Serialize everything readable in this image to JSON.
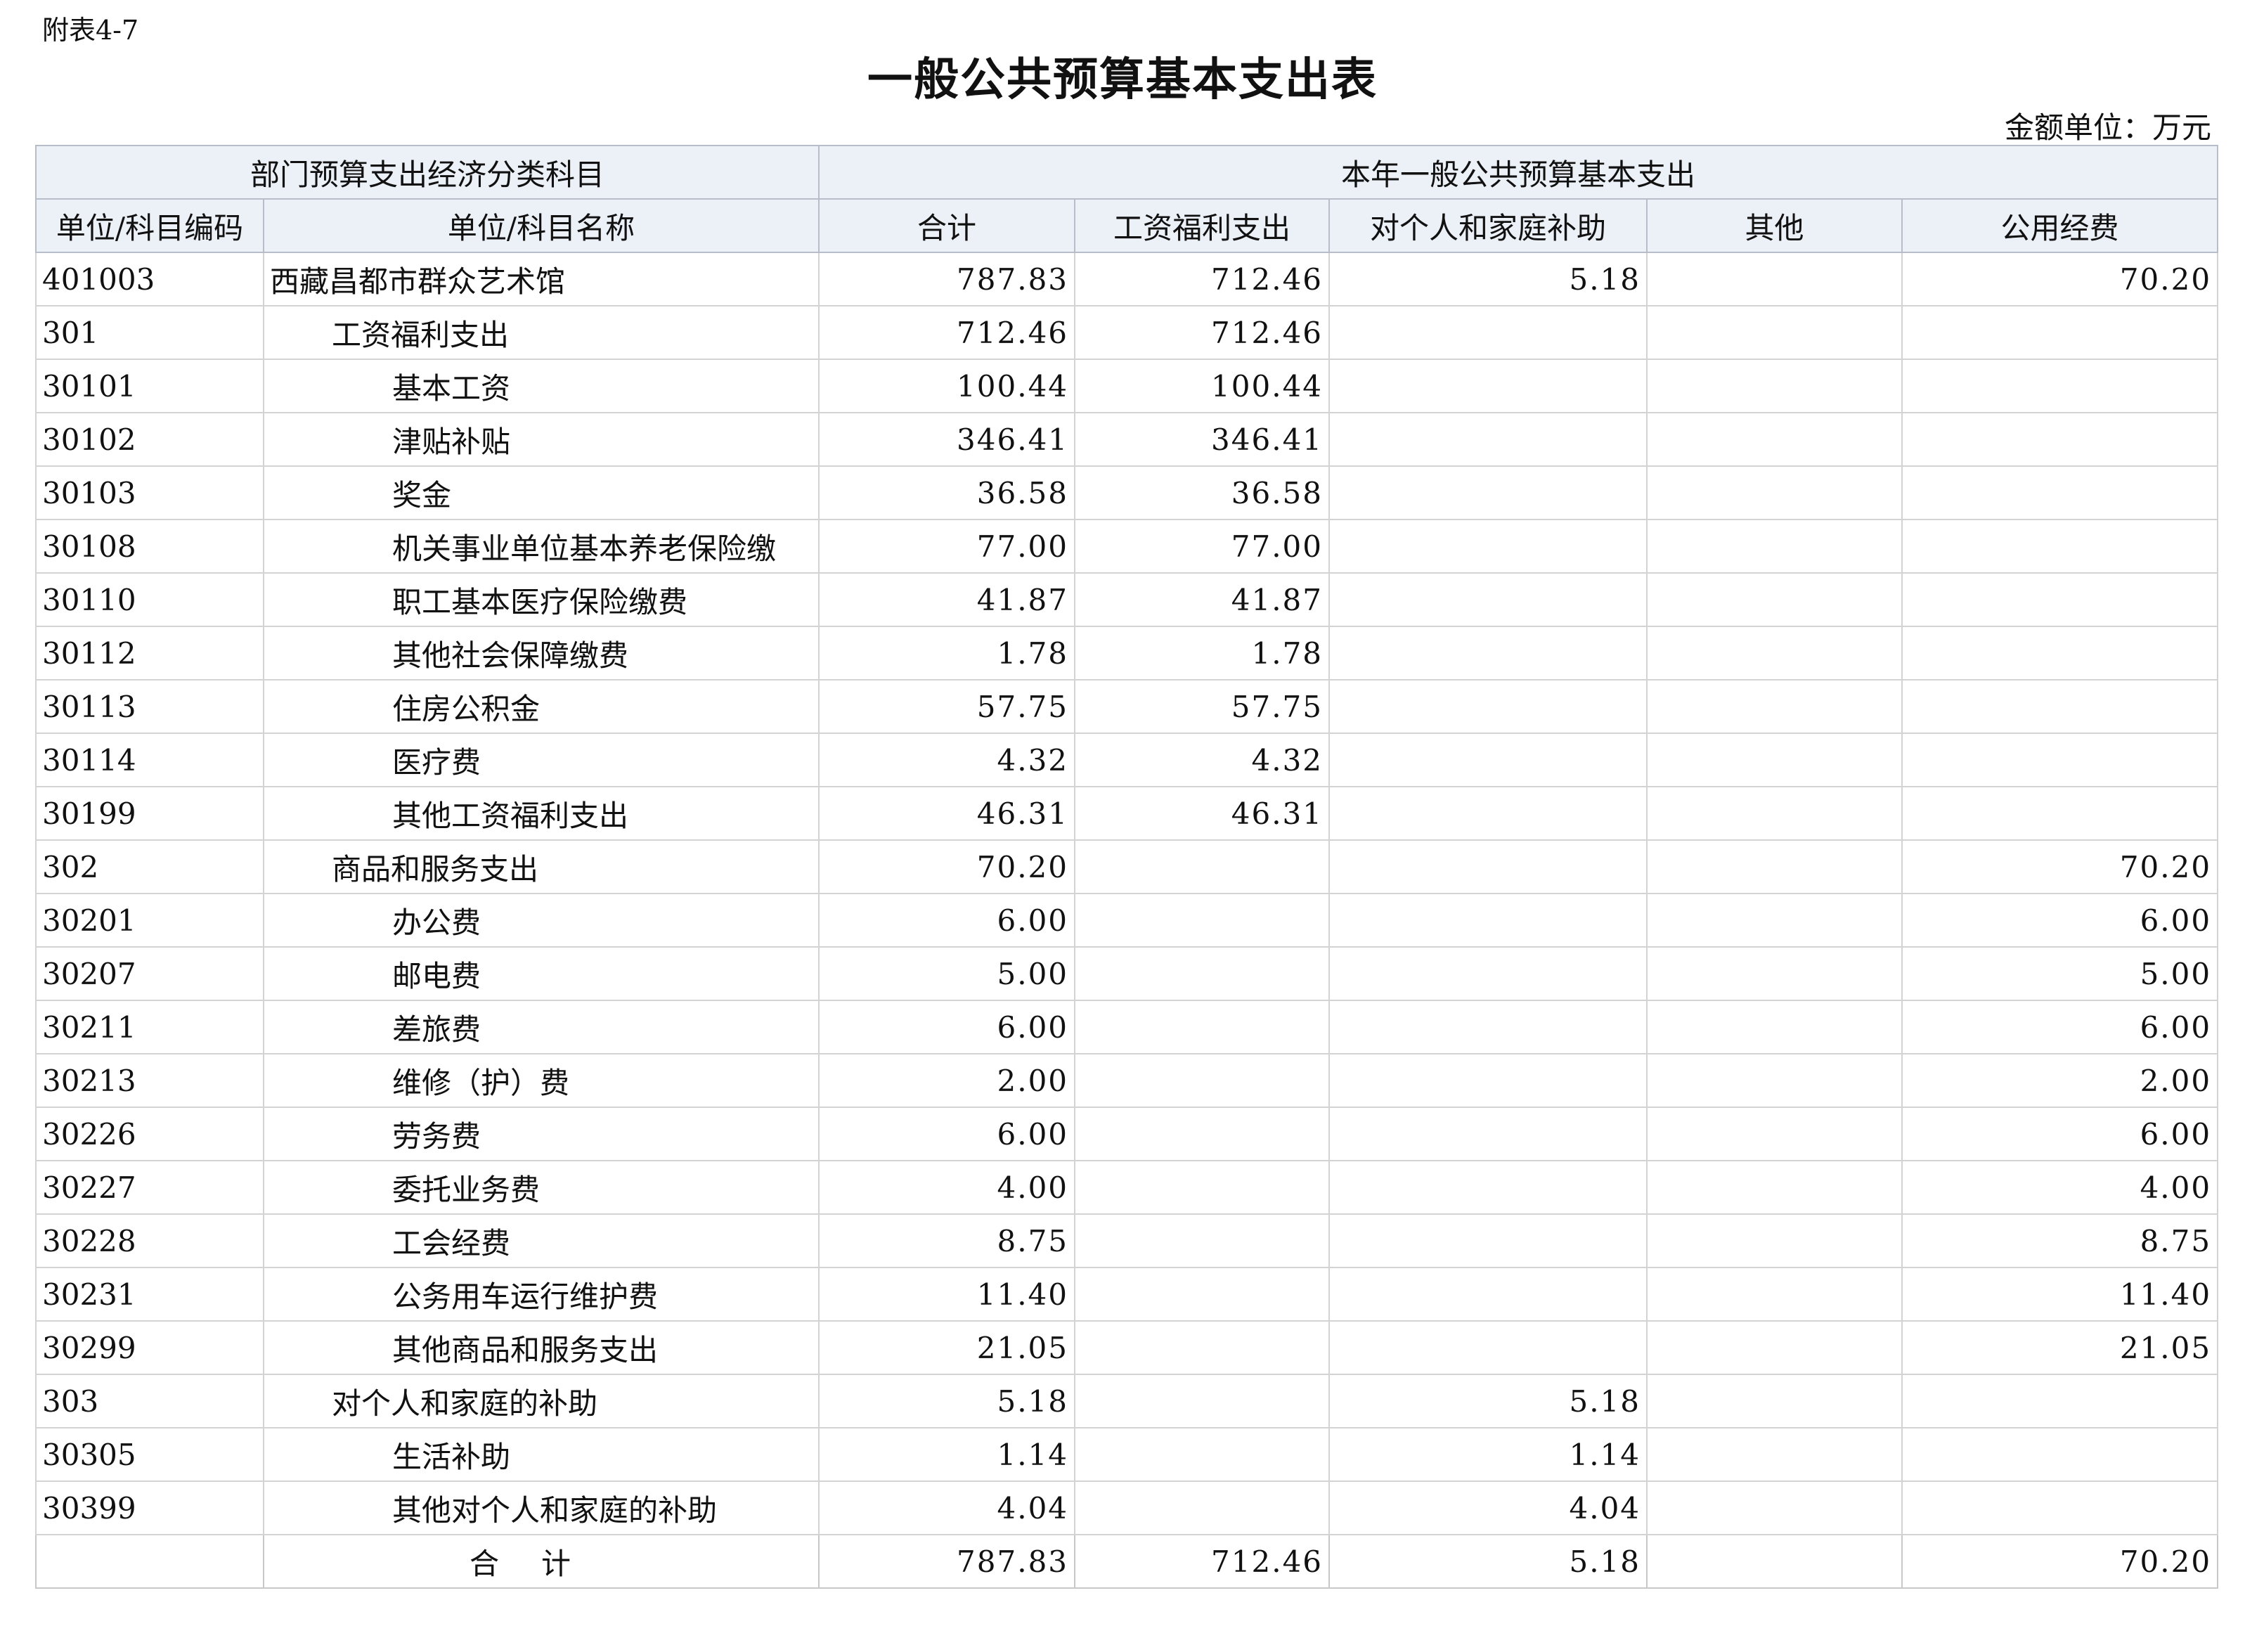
{
  "annex_label": "附表4-7",
  "title": "一般公共预算基本支出表",
  "unit_label": "金额单位：万元",
  "header": {
    "group1": "部门预算支出经济分类科目",
    "group2": "本年一般公共预算基本支出",
    "col_code": "单位/科目编码",
    "col_name": "单位/科目名称",
    "col_total": "合计",
    "col_salary": "工资福利支出",
    "col_subsidy": "对个人和家庭补助",
    "col_other": "其他",
    "col_public": "公用经费"
  },
  "rows": [
    {
      "code": "401003",
      "name": "西藏昌都市群众艺术馆",
      "level": 1,
      "total": "787.83",
      "salary": "712.46",
      "subsidy": "5.18",
      "other": "",
      "public": "70.20"
    },
    {
      "code": "301",
      "name": "工资福利支出",
      "level": 2,
      "total": "712.46",
      "salary": "712.46",
      "subsidy": "",
      "other": "",
      "public": ""
    },
    {
      "code": "30101",
      "name": "基本工资",
      "level": 3,
      "total": "100.44",
      "salary": "100.44",
      "subsidy": "",
      "other": "",
      "public": ""
    },
    {
      "code": "30102",
      "name": "津贴补贴",
      "level": 3,
      "total": "346.41",
      "salary": "346.41",
      "subsidy": "",
      "other": "",
      "public": ""
    },
    {
      "code": "30103",
      "name": "奖金",
      "level": 3,
      "total": "36.58",
      "salary": "36.58",
      "subsidy": "",
      "other": "",
      "public": ""
    },
    {
      "code": "30108",
      "name": "机关事业单位基本养老保险缴",
      "level": 3,
      "total": "77.00",
      "salary": "77.00",
      "subsidy": "",
      "other": "",
      "public": ""
    },
    {
      "code": "30110",
      "name": "职工基本医疗保险缴费",
      "level": 3,
      "total": "41.87",
      "salary": "41.87",
      "subsidy": "",
      "other": "",
      "public": ""
    },
    {
      "code": "30112",
      "name": "其他社会保障缴费",
      "level": 3,
      "total": "1.78",
      "salary": "1.78",
      "subsidy": "",
      "other": "",
      "public": ""
    },
    {
      "code": "30113",
      "name": "住房公积金",
      "level": 3,
      "total": "57.75",
      "salary": "57.75",
      "subsidy": "",
      "other": "",
      "public": ""
    },
    {
      "code": "30114",
      "name": "医疗费",
      "level": 3,
      "total": "4.32",
      "salary": "4.32",
      "subsidy": "",
      "other": "",
      "public": ""
    },
    {
      "code": "30199",
      "name": "其他工资福利支出",
      "level": 3,
      "total": "46.31",
      "salary": "46.31",
      "subsidy": "",
      "other": "",
      "public": ""
    },
    {
      "code": "302",
      "name": "商品和服务支出",
      "level": 2,
      "total": "70.20",
      "salary": "",
      "subsidy": "",
      "other": "",
      "public": "70.20"
    },
    {
      "code": "30201",
      "name": "办公费",
      "level": 3,
      "total": "6.00",
      "salary": "",
      "subsidy": "",
      "other": "",
      "public": "6.00"
    },
    {
      "code": "30207",
      "name": "邮电费",
      "level": 3,
      "total": "5.00",
      "salary": "",
      "subsidy": "",
      "other": "",
      "public": "5.00"
    },
    {
      "code": "30211",
      "name": "差旅费",
      "level": 3,
      "total": "6.00",
      "salary": "",
      "subsidy": "",
      "other": "",
      "public": "6.00"
    },
    {
      "code": "30213",
      "name": "维修（护）费",
      "level": 3,
      "total": "2.00",
      "salary": "",
      "subsidy": "",
      "other": "",
      "public": "2.00"
    },
    {
      "code": "30226",
      "name": "劳务费",
      "level": 3,
      "total": "6.00",
      "salary": "",
      "subsidy": "",
      "other": "",
      "public": "6.00"
    },
    {
      "code": "30227",
      "name": "委托业务费",
      "level": 3,
      "total": "4.00",
      "salary": "",
      "subsidy": "",
      "other": "",
      "public": "4.00"
    },
    {
      "code": "30228",
      "name": "工会经费",
      "level": 3,
      "total": "8.75",
      "salary": "",
      "subsidy": "",
      "other": "",
      "public": "8.75"
    },
    {
      "code": "30231",
      "name": "公务用车运行维护费",
      "level": 3,
      "total": "11.40",
      "salary": "",
      "subsidy": "",
      "other": "",
      "public": "11.40"
    },
    {
      "code": "30299",
      "name": "其他商品和服务支出",
      "level": 3,
      "total": "21.05",
      "salary": "",
      "subsidy": "",
      "other": "",
      "public": "21.05"
    },
    {
      "code": "303",
      "name": "对个人和家庭的补助",
      "level": 2,
      "total": "5.18",
      "salary": "",
      "subsidy": "5.18",
      "other": "",
      "public": ""
    },
    {
      "code": "30305",
      "name": "生活补助",
      "level": 3,
      "total": "1.14",
      "salary": "",
      "subsidy": "1.14",
      "other": "",
      "public": ""
    },
    {
      "code": "30399",
      "name": "其他对个人和家庭的补助",
      "level": 3,
      "total": "4.04",
      "salary": "",
      "subsidy": "4.04",
      "other": "",
      "public": ""
    }
  ],
  "total_row": {
    "label": "合计",
    "total": "787.83",
    "salary": "712.46",
    "subsidy": "5.18",
    "other": "",
    "public": "70.20"
  }
}
